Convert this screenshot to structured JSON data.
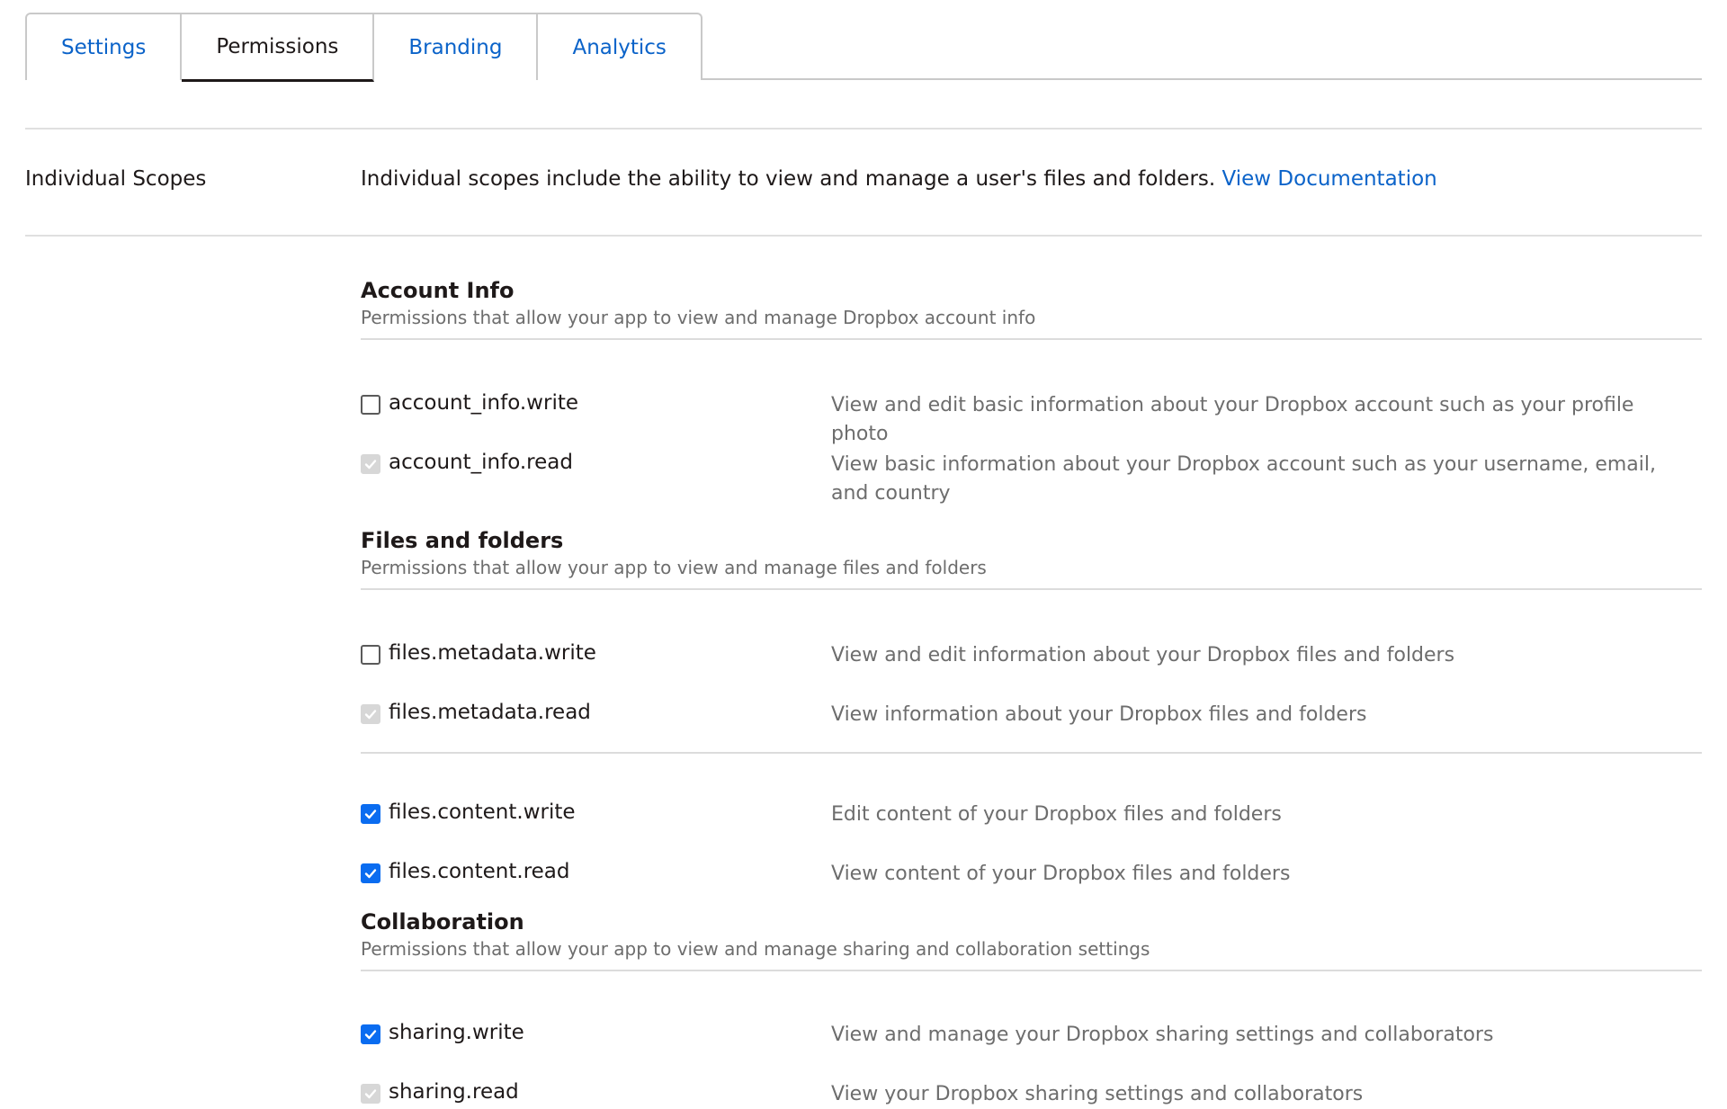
{
  "tabs": [
    {
      "label": "Settings",
      "active": false
    },
    {
      "label": "Permissions",
      "active": true
    },
    {
      "label": "Branding",
      "active": false
    },
    {
      "label": "Analytics",
      "active": false
    }
  ],
  "individual_scopes": {
    "label": "Individual Scopes",
    "description": "Individual scopes include the ability to view and manage a user's files and folders.",
    "link_text": "View Documentation"
  },
  "sections": [
    {
      "title": "Account Info",
      "subtitle": "Permissions that allow your app to view and manage Dropbox account info",
      "permissions": [
        {
          "name": "account_info.write",
          "state": "unchecked",
          "description": "View and edit basic information about your Dropbox account such as your profile photo"
        },
        {
          "name": "account_info.read",
          "state": "disabled",
          "description": "View basic information about your Dropbox account such as your username, email, and country"
        }
      ]
    },
    {
      "title": "Files and folders",
      "subtitle": "Permissions that allow your app to view and manage files and folders",
      "permissions": [
        {
          "name": "files.metadata.write",
          "state": "unchecked",
          "description": "View and edit information about your Dropbox files and folders"
        },
        {
          "name": "files.metadata.read",
          "state": "disabled",
          "description": "View information about your Dropbox files and folders"
        },
        {
          "name": "files.content.write",
          "state": "checked",
          "description": "Edit content of your Dropbox files and folders"
        },
        {
          "name": "files.content.read",
          "state": "checked",
          "description": "View content of your Dropbox files and folders"
        }
      ]
    },
    {
      "title": "Collaboration",
      "subtitle": "Permissions that allow your app to view and manage sharing and collaboration settings",
      "permissions": [
        {
          "name": "sharing.write",
          "state": "checked",
          "description": "View and manage your Dropbox sharing settings and collaborators"
        },
        {
          "name": "sharing.read",
          "state": "disabled",
          "description": "View your Dropbox sharing settings and collaborators"
        }
      ]
    }
  ],
  "colors": {
    "link": "#0b63c9",
    "checkbox_checked": "#0a6cf0",
    "checkbox_disabled": "#d7d7d7",
    "muted_text": "#6d6d6d"
  }
}
